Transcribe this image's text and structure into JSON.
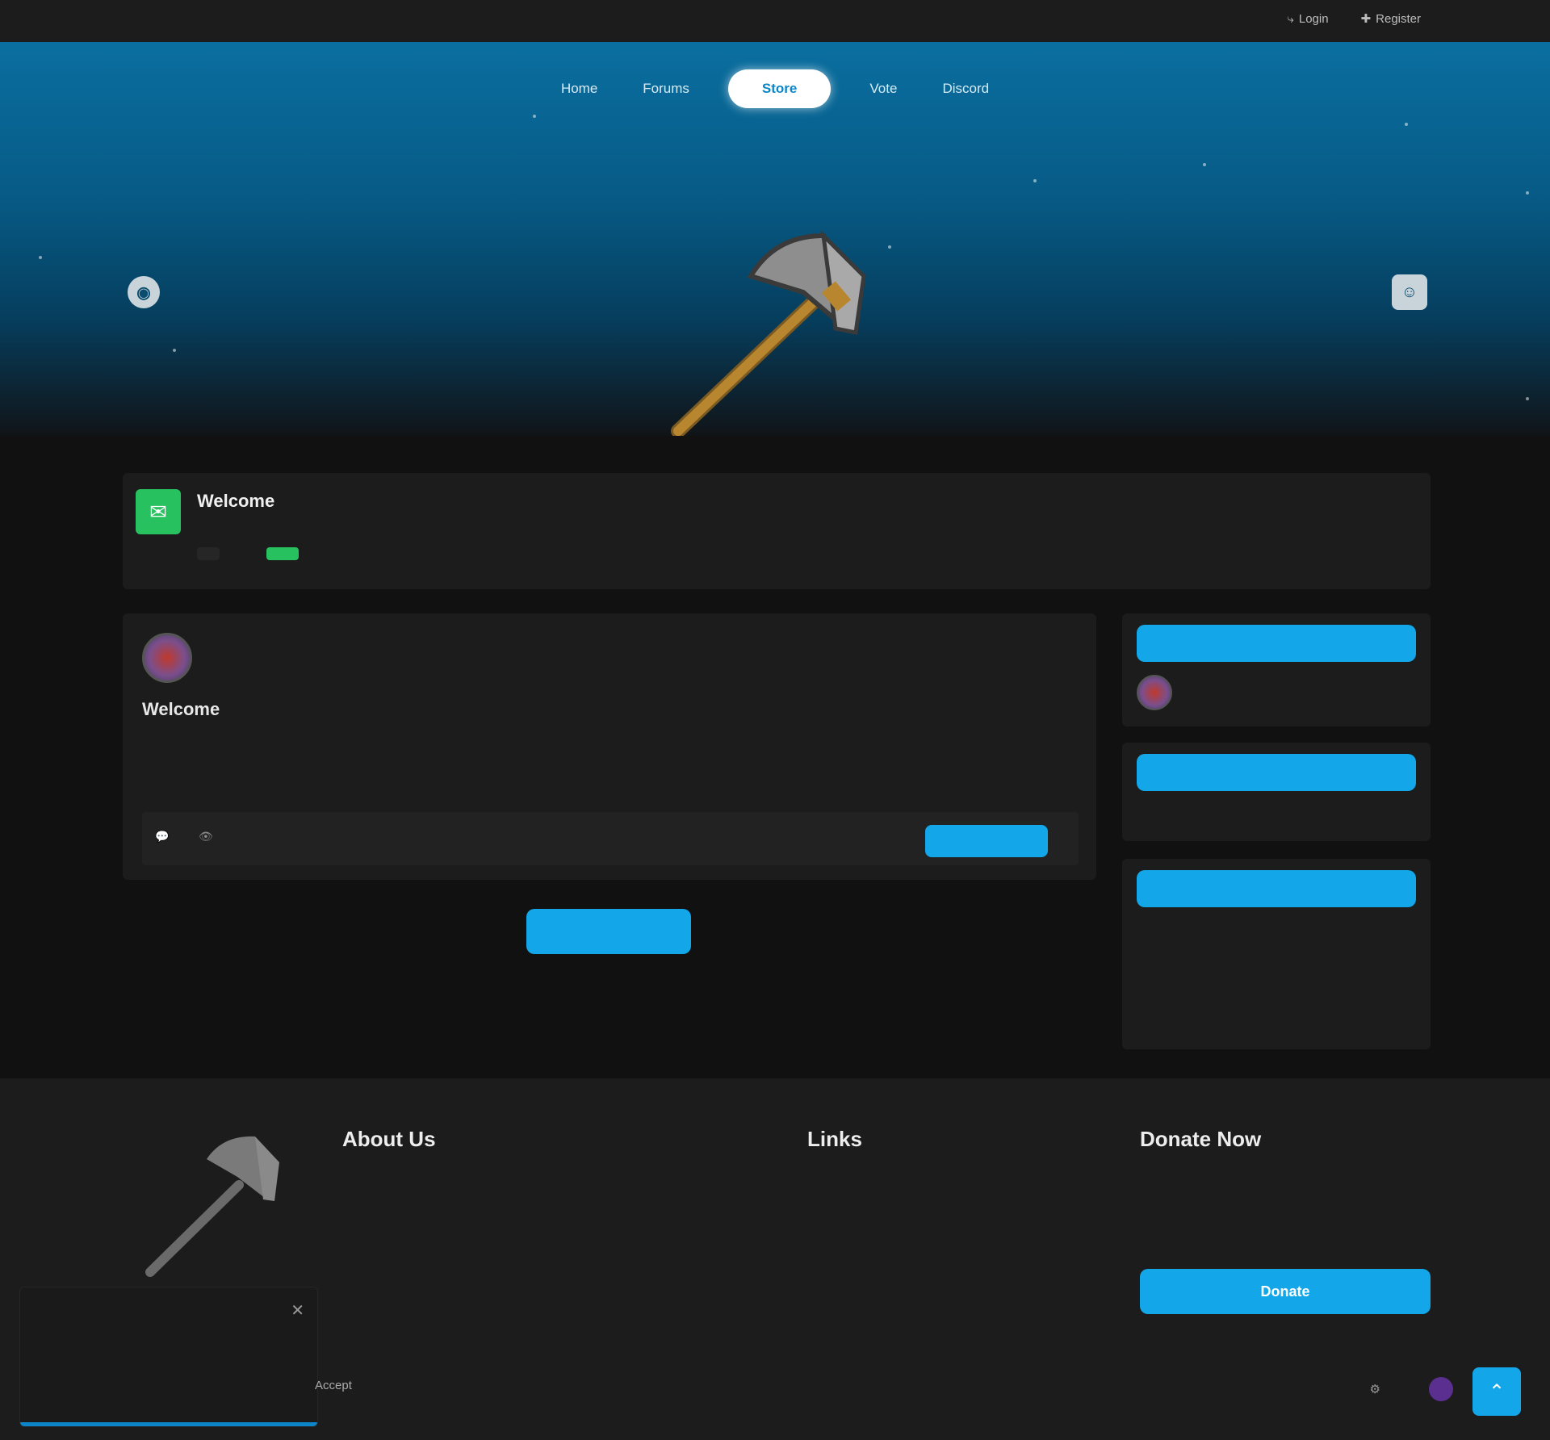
{
  "topbar": {
    "login": "Login",
    "register": "Register"
  },
  "nav": {
    "items": [
      "Home",
      "Forums",
      "Store",
      "Vote",
      "Discord"
    ],
    "active_index": 2
  },
  "hero": {
    "left_title": "",
    "left_sub": "",
    "right_title": "",
    "right_sub": ""
  },
  "welcome": {
    "title": "Welcome",
    "desc": "",
    "tag": "",
    "badge": ""
  },
  "post": {
    "title": "",
    "author": "",
    "date": "",
    "heading": "Welcome",
    "body": "",
    "read_more": ""
  },
  "load_more": "",
  "sidebar": {
    "s1_header": "",
    "s1_user": "",
    "s2_header": "",
    "s2_text": "",
    "s3_header": "",
    "s3_rows": [
      {
        "label": "",
        "value": ""
      },
      {
        "label": "",
        "value": ""
      },
      {
        "label": "",
        "value": ""
      },
      {
        "label": "",
        "value": ""
      },
      {
        "label": "",
        "value": ""
      }
    ]
  },
  "footer": {
    "about_title": "About Us",
    "about_text": "",
    "links_title": "Links",
    "links": [
      "",
      ""
    ],
    "donate_title": "Donate Now",
    "donate_text": "",
    "donate_btn": "Donate"
  },
  "cookie": {
    "text": "",
    "accept": "Accept"
  },
  "bottom": {
    "label": ""
  },
  "colors": {
    "accent": "#13a6e8",
    "green": "#27c160",
    "author_red": "#d62e2e"
  }
}
